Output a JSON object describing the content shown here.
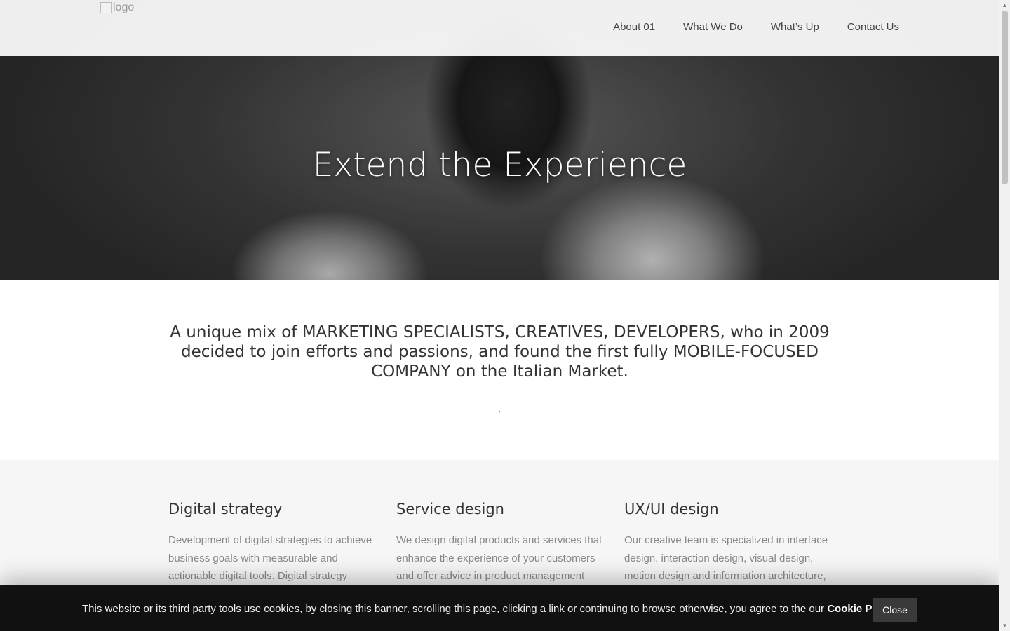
{
  "header": {
    "logo_alt": "logo",
    "nav": [
      {
        "label": "About 01"
      },
      {
        "label": "What We Do"
      },
      {
        "label": "What’s Up"
      },
      {
        "label": "Contact Us"
      }
    ]
  },
  "hero": {
    "title": "Extend the Experience"
  },
  "intro": {
    "text": "A unique mix of MARKETING SPECIALISTS, CREATIVES, DEVELOPERS, who in 2009 decided to join efforts and passions, and found the first fully MOBILE-FOCUSED COMPANY on the Italian Market."
  },
  "services": [
    {
      "title": "Digital strategy",
      "text": "Development of digital strategies to achieve business goals with measurable and actionable digital tools. Digital strategy"
    },
    {
      "title": "Service design",
      "text": "We design digital products and services that enhance the experience of your customers and offer advice in product management and"
    },
    {
      "title": "UX/UI design",
      "text": "Our creative team is specialized in interface design, interaction design, visual design, motion design and information architecture,"
    }
  ],
  "cookie_banner": {
    "text_before": "This website or its third party tools use cookies, by closing this banner, scrolling this page, clicking a link or continuing to browse otherwise, you agree to the our ",
    "link_label": "Cookie Policy",
    "text_after": ".",
    "close_label": "Close"
  },
  "icons": {
    "scroll_up": "arrow-up-icon",
    "scroll_down": "arrow-down-icon",
    "logo": "broken-image-icon"
  },
  "colors": {
    "header_bg": "#ffffff",
    "cookie_bg": "#111111",
    "services_bg": "#f6f6f6",
    "close_button_bg": "#3a3a3a"
  }
}
